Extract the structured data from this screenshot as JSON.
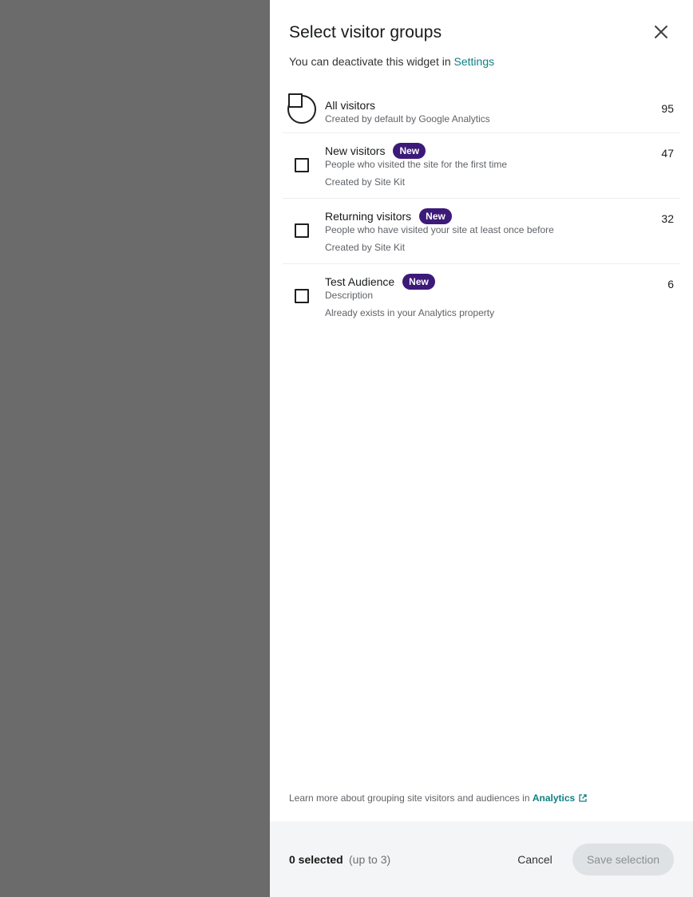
{
  "panel": {
    "title": "Select visitor groups",
    "subtitle_prefix": "You can deactivate this widget in",
    "subtitle_link": "Settings"
  },
  "groups": [
    {
      "name": "All visitors",
      "badge": "",
      "desc1": "Created by default by Google Analytics",
      "desc2": "",
      "count": "95",
      "selected": false
    },
    {
      "name": "New visitors",
      "badge": "New",
      "desc1": "People who visited the site for the first time",
      "desc2": "Created by Site Kit",
      "count": "47",
      "selected": false
    },
    {
      "name": "Returning visitors",
      "badge": "New",
      "desc1": "People who have visited your site at least once before",
      "desc2": "Created by Site Kit",
      "count": "32",
      "selected": false
    },
    {
      "name": "Test Audience",
      "badge": "New",
      "desc1": "Description",
      "desc2": "Already exists in your Analytics property",
      "count": "6",
      "selected": false
    }
  ],
  "learn_more": {
    "prefix": "Learn more about grouping site visitors and audiences in",
    "link": "Analytics",
    "icon": "external-link-icon"
  },
  "footer": {
    "selected_count": "0 selected",
    "limit": "(up to 3)",
    "cancel_label": "Cancel",
    "save_label": "Save selection",
    "save_enabled": false
  },
  "colors": {
    "backdrop": "#6b6b6b",
    "link": "#108080",
    "badge": "#3c1a78",
    "footer_bg": "#f3f5f7",
    "disabled_button": "#dfe2e4"
  },
  "icons": {
    "close": "close-icon"
  }
}
